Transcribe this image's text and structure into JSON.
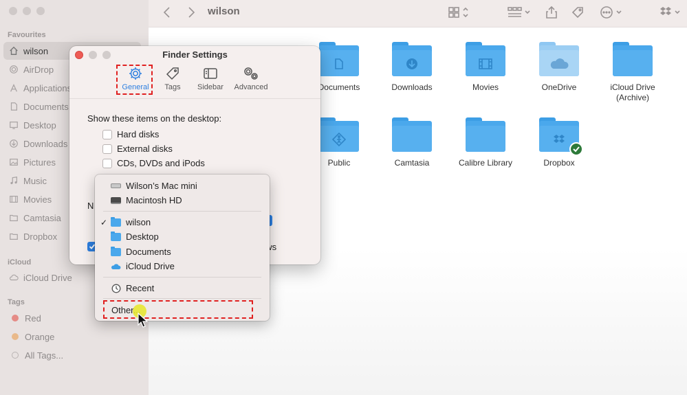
{
  "sidebar": {
    "favourites_header": "Favourites",
    "icloud_header": "iCloud",
    "tags_header": "Tags",
    "favourites": [
      {
        "label": "wilson",
        "icon": "home-icon",
        "active": true
      },
      {
        "label": "AirDrop",
        "icon": "airdrop-icon"
      },
      {
        "label": "Applications",
        "icon": "applications-icon"
      },
      {
        "label": "Documents",
        "icon": "document-icon"
      },
      {
        "label": "Desktop",
        "icon": "desktop-icon"
      },
      {
        "label": "Downloads",
        "icon": "download-icon"
      },
      {
        "label": "Pictures",
        "icon": "pictures-icon"
      },
      {
        "label": "Music",
        "icon": "music-icon"
      },
      {
        "label": "Movies",
        "icon": "movies-icon"
      },
      {
        "label": "Camtasia",
        "icon": "folder-icon"
      },
      {
        "label": "Dropbox",
        "icon": "folder-icon"
      }
    ],
    "icloud": [
      {
        "label": "iCloud Drive",
        "icon": "cloud-icon"
      }
    ],
    "tags": [
      {
        "label": "Red",
        "color": "#e58b86"
      },
      {
        "label": "Orange",
        "color": "#e9b98a"
      },
      {
        "label": "All Tags...",
        "color": "#c9c4c3"
      }
    ]
  },
  "toolbar": {
    "title": "wilson"
  },
  "files": [
    {
      "name": "Documents",
      "glyph": "document-icon"
    },
    {
      "name": "Downloads",
      "glyph": "download-icon"
    },
    {
      "name": "Movies",
      "glyph": "movies-icon"
    },
    {
      "name": "OneDrive",
      "glyph": "cloud-icon"
    },
    {
      "name": "iCloud Drive (Archive)",
      "glyph": "none"
    },
    {
      "name": "Public",
      "glyph": "public-icon"
    },
    {
      "name": "Camtasia",
      "glyph": "none"
    },
    {
      "name": "Calibre Library",
      "glyph": "none"
    },
    {
      "name": "Dropbox",
      "glyph": "dropbox-icon"
    }
  ],
  "settings": {
    "title": "Finder Settings",
    "tabs": [
      "General",
      "Tags",
      "Sidebar",
      "Advanced"
    ],
    "active_tab": "General",
    "desktop_label": "Show these items on the desktop:",
    "desktop_items": [
      "Hard disks",
      "External disks",
      "CDs, DVDs and iPods"
    ],
    "partial_new_window_label": "N",
    "partial_open_label": "ows"
  },
  "menu": {
    "items": [
      {
        "label": "Wilson’s Mac mini",
        "icon": "computer-icon"
      },
      {
        "label": "Macintosh HD",
        "icon": "disk-icon"
      },
      {
        "label": "wilson",
        "icon": "folder-icon",
        "checked": true
      },
      {
        "label": "Desktop",
        "icon": "folder-icon"
      },
      {
        "label": "Documents",
        "icon": "folder-icon"
      },
      {
        "label": "iCloud Drive",
        "icon": "cloud-icon"
      },
      {
        "label": "Recent",
        "icon": "clock-icon"
      },
      {
        "label": "Other...",
        "icon": "none"
      }
    ],
    "check_mark": "✓"
  },
  "colors": {
    "accent": "#2d7fe0",
    "highlight": "#e02020"
  }
}
